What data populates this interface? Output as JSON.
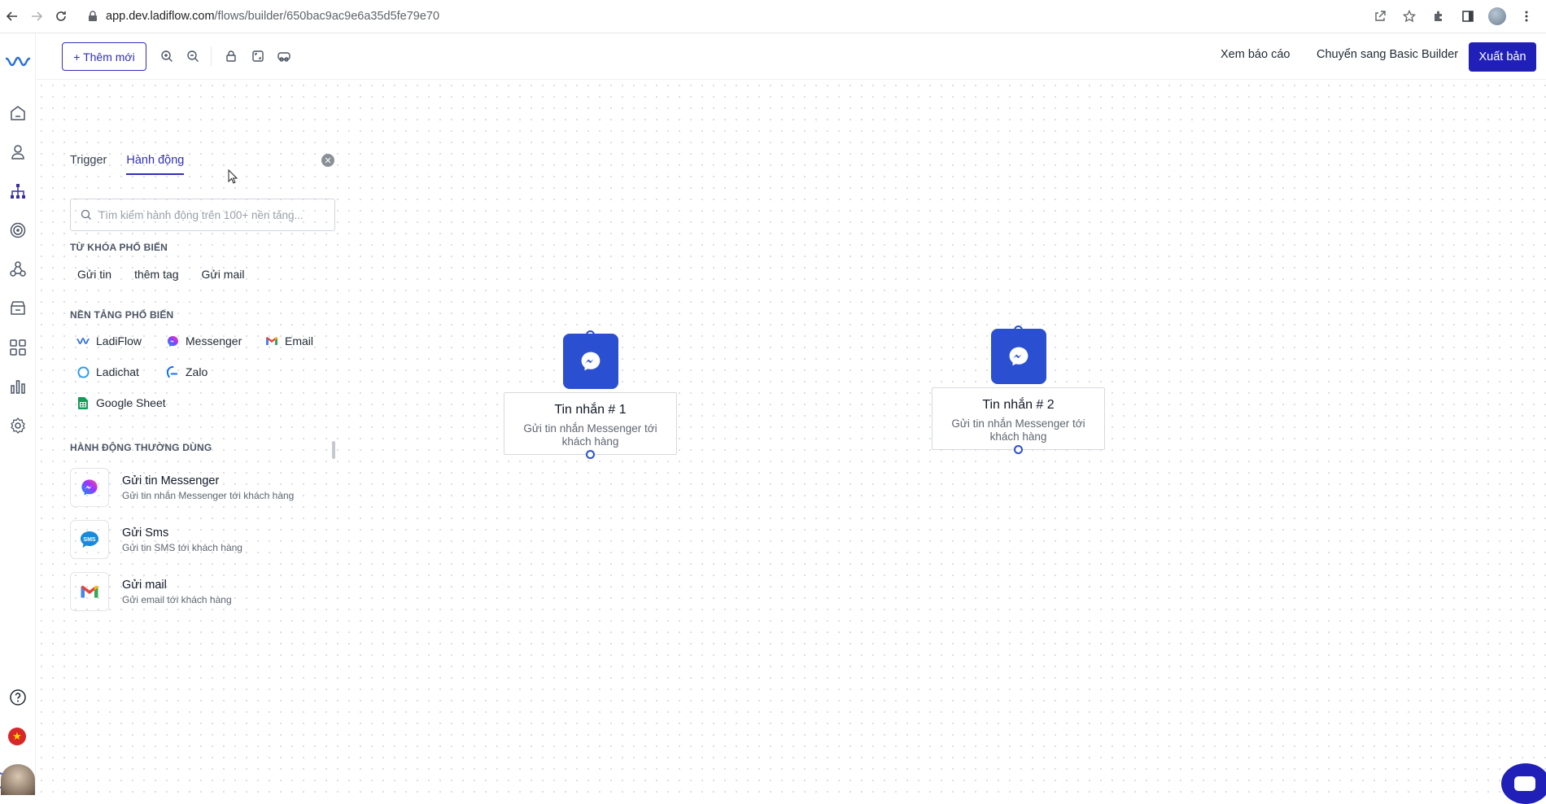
{
  "browser": {
    "url_host": "app.dev.ladiflow.com",
    "url_path": "/flows/builder/650bac9ac9e6a35d5fe79e70"
  },
  "toolbar": {
    "add_label": "+ Thêm mới",
    "report_label": "Xem báo cáo",
    "basic_builder_label": "Chuyển sang Basic Builder",
    "publish_label": "Xuất bản"
  },
  "panel": {
    "tabs": [
      "Trigger",
      "Hành động"
    ],
    "active_tab": "Hành động",
    "search_placeholder": "Tìm kiếm hành động trên 100+ nền tảng...",
    "popular_keywords_title": "TỪ KHÓA PHỔ BIẾN",
    "keywords": [
      "Gửi tin",
      "thêm tag",
      "Gửi mail"
    ],
    "popular_platforms_title": "NỀN TẢNG PHỔ BIẾN",
    "platforms": [
      {
        "label": "LadiFlow",
        "icon": "ladiflow-icon"
      },
      {
        "label": "Messenger",
        "icon": "messenger-icon"
      },
      {
        "label": "Email",
        "icon": "gmail-icon"
      },
      {
        "label": "Ladichat",
        "icon": "ladichat-icon"
      },
      {
        "label": "Zalo",
        "icon": "zalo-icon"
      },
      {
        "label": "Google Sheet",
        "icon": "google-sheet-icon"
      }
    ],
    "common_actions_title": "HÀNH ĐỘNG THƯỜNG DÙNG",
    "actions": [
      {
        "title": "Gửi tin Messenger",
        "desc": "Gửi tin nhắn Messenger tới khách hàng",
        "icon": "messenger-icon"
      },
      {
        "title": "Gửi Sms",
        "desc": "Gửi tin SMS tới khách hàng",
        "icon": "sms-icon",
        "icon_text": "SMS"
      },
      {
        "title": "Gửi mail",
        "desc": "Gửi email tới khách hàng",
        "icon": "gmail-icon"
      }
    ]
  },
  "nodes": [
    {
      "title": "Tin nhắn # 1",
      "desc": "Gửi tin nhắn Messenger tới khách hàng",
      "icon": "messenger-icon"
    },
    {
      "title": "Tin nhắn # 2",
      "desc": "Gửi tin nhắn Messenger tới khách hàng",
      "icon": "messenger-icon"
    }
  ],
  "colors": {
    "primary": "#2020b9",
    "node_blue": "#2b4fd1",
    "messenger_gradient": [
      "#0099ff",
      "#a033ff",
      "#ff5280"
    ]
  }
}
